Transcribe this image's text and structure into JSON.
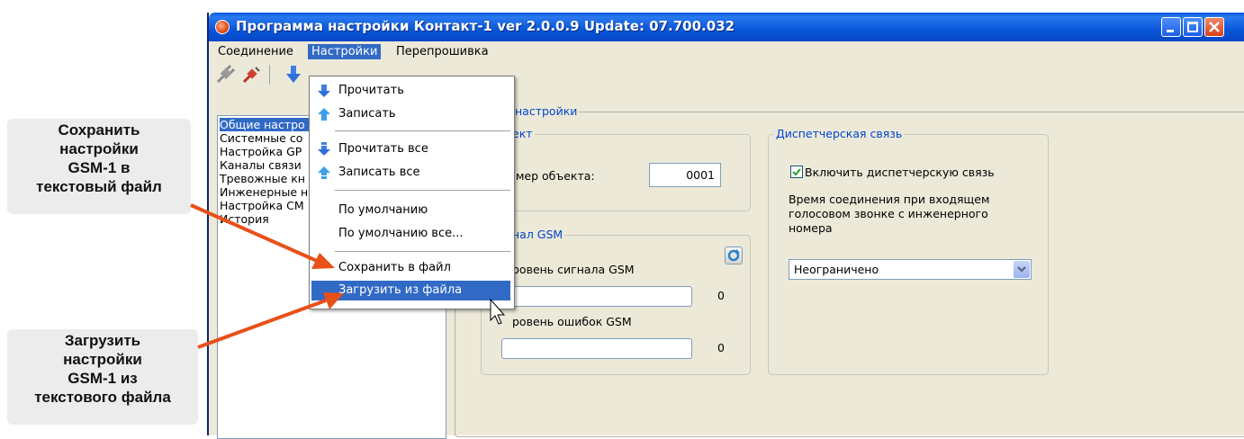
{
  "callouts": {
    "save": [
      "Сохранить",
      "настройки",
      "GSM-1 в",
      "текстовый файл"
    ],
    "load": [
      "Загрузить",
      "настройки",
      "GSM-1 из",
      "текстового файла"
    ]
  },
  "window": {
    "title": "Программа настройки Контакт-1 ver 2.0.0.9 Update: 07.700.032"
  },
  "menubar": [
    "Соединение",
    "Настройки",
    "Перепрошивка"
  ],
  "dropdown": {
    "read": "Прочитать",
    "write": "Записать",
    "read_all": "Прочитать все",
    "write_all": "Записать все",
    "default": "По умолчанию",
    "default_all": "По умолчанию все...",
    "save_file": "Сохранить в файл",
    "load_file": "Загрузить из файла"
  },
  "tree": [
    "Общие настро",
    "Системные со",
    "Настройка GP",
    "Каналы связи",
    "Тревожные кн",
    "Инженерные н",
    "Настройка СМ",
    "История"
  ],
  "panel": {
    "general_legend": "настройки",
    "object_legend": "ект",
    "object_number_label": "мер объекта:",
    "object_number": "0001",
    "gsm_legend": "нал GSM",
    "signal_label": "ровень сигнала GSM",
    "signal_value": "0",
    "errors_label": "ровень ошибок GSM",
    "errors_value": "0",
    "dispatch_legend": "Диспетчерская связь",
    "dispatch_checkbox": "Включить диспетчерскую связь",
    "dispatch_text1": "Время соединения при входящем",
    "dispatch_text2": "голосовом звонке с инженерного",
    "dispatch_text3": "номера",
    "dispatch_select": "Неограничено"
  },
  "colors": {
    "accent": "#316ac5",
    "arrow": "#e8501a",
    "titlebar": "#0856d8"
  }
}
